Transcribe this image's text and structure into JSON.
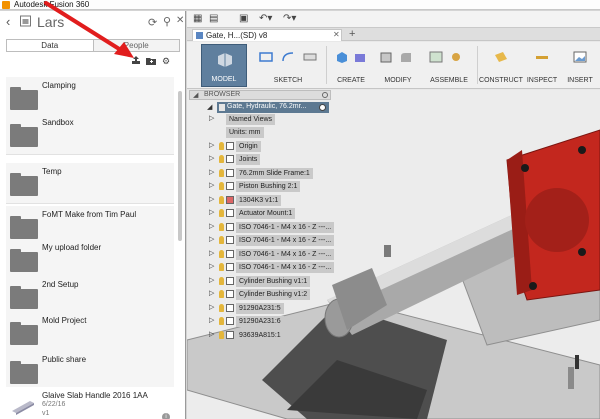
{
  "app": {
    "title": "Autodesk Fusion 360"
  },
  "data_panel": {
    "project": "Lars",
    "tabs": [
      "Data",
      "People"
    ],
    "items": [
      {
        "name": "Clamping"
      },
      {
        "name": "Sandbox"
      },
      {
        "name": "Temp"
      },
      {
        "name": "FoMT Make from Tim Paul"
      },
      {
        "name": "My upload folder"
      },
      {
        "name": "2nd Setup"
      },
      {
        "name": "Mold Project"
      },
      {
        "name": "Public share"
      }
    ],
    "file": {
      "name": "Glaive Slab Handle 2016 1AA",
      "date": "6/22/16",
      "version": "v1"
    }
  },
  "document": {
    "tab_label": "Gate, H...(SD) v8"
  },
  "toolbar": {
    "model": "MODEL",
    "sketch": "SKETCH",
    "create": "CREATE",
    "modify": "MODIFY",
    "assemble": "ASSEMBLE",
    "construct": "CONSTRUCT",
    "inspect": "INSPECT",
    "insert": "INSERT"
  },
  "browser": {
    "header": "BROWSER",
    "root": "Gate, Hydraulic, 76.2mr...",
    "nodes": [
      "Named Views",
      "Units: mm",
      "Origin",
      "Joints",
      "76.2mm Slide Frame:1",
      "Piston Bushing 2:1",
      "1304K3 v1:1",
      "Actuator Mount:1",
      "ISO 7046-1 - M4 x 16 - Z ---...",
      "ISO 7046-1 - M4 x 16 - Z ---...",
      "ISO 7046-1 - M4 x 16 - Z ---...",
      "ISO 7046-1 - M4 x 16 - Z ---...",
      "Cylinder Bushing v1:1",
      "Cylinder Bushing v1:2",
      "91290A231:5",
      "91290A231:6",
      "93639A815:1"
    ]
  },
  "colors": {
    "accent": "#5f7f9e",
    "annotation": "#e11d1d",
    "part_red": "#c3271e"
  }
}
